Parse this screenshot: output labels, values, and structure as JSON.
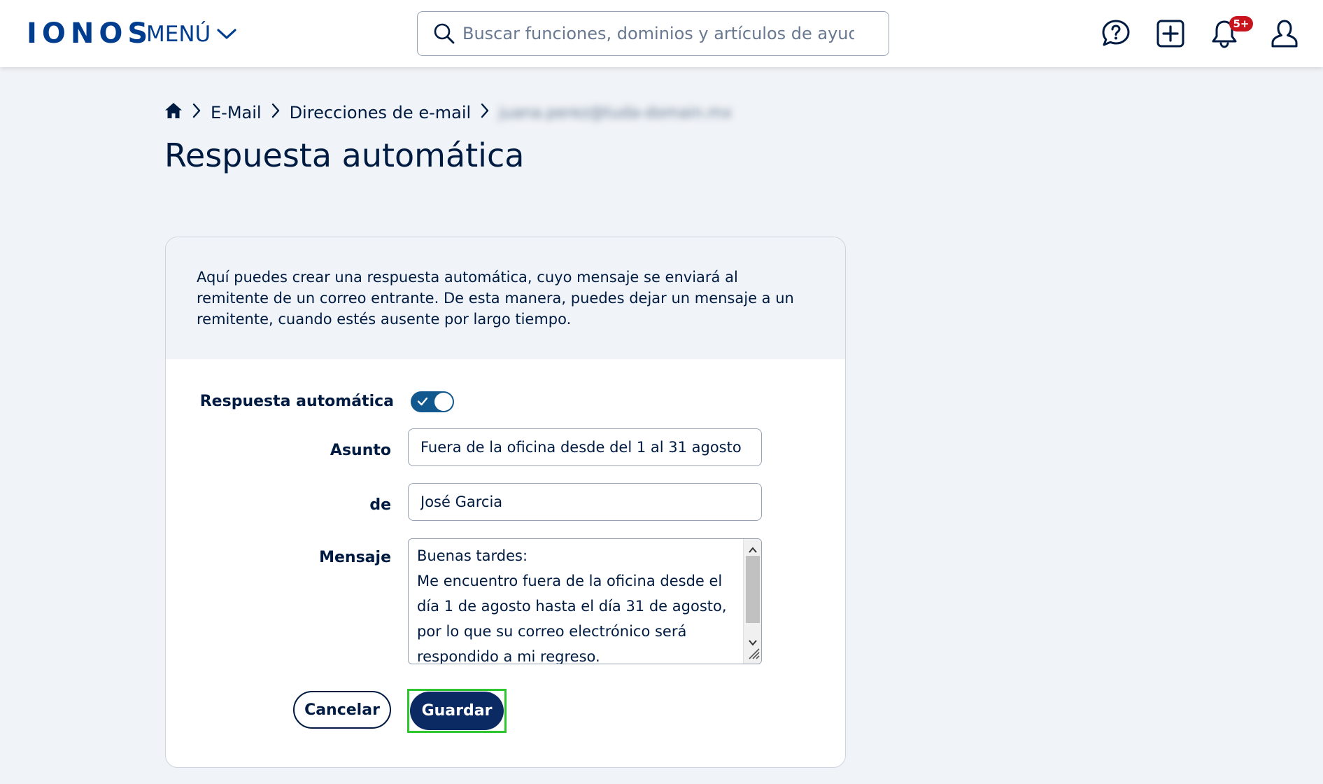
{
  "header": {
    "logo": "IONOS",
    "menu_label": "MENÚ",
    "search_placeholder": "Buscar funciones, dominios y artículos de ayuda",
    "notification_count": "5+"
  },
  "breadcrumb": {
    "items": [
      "E-Mail",
      "Direcciones de e-mail"
    ],
    "current_email": "juana.perez@tuda-domain.mx"
  },
  "page": {
    "title": "Respuesta automática"
  },
  "card": {
    "intro": "Aquí puedes crear una respuesta automática, cuyo mensaje se enviará al remitente de un correo entrante. De esta manera, puedes dejar un mensaje a un remitente, cuando estés ausente por largo tiempo."
  },
  "form": {
    "toggle_label": "Respuesta automática",
    "toggle_on": true,
    "subject_label": "Asunto",
    "subject_value": "Fuera de la oficina desde del 1 al 31 agosto",
    "from_label": "de",
    "from_value": "José Garcia",
    "message_label": "Mensaje",
    "message_value": "Buenas tardes:\nMe encuentro fuera de la oficina desde el día 1 de agosto hasta el día 31 de agosto, por lo que su correo electrónico será respondido a mi regreso.",
    "cancel_label": "Cancelar",
    "save_label": "Guardar"
  },
  "colors": {
    "brand": "#003d8f",
    "primary_button": "#0b2a63",
    "toggle_on": "#11588f",
    "badge": "#c8151d",
    "highlight": "#2ec52e"
  }
}
